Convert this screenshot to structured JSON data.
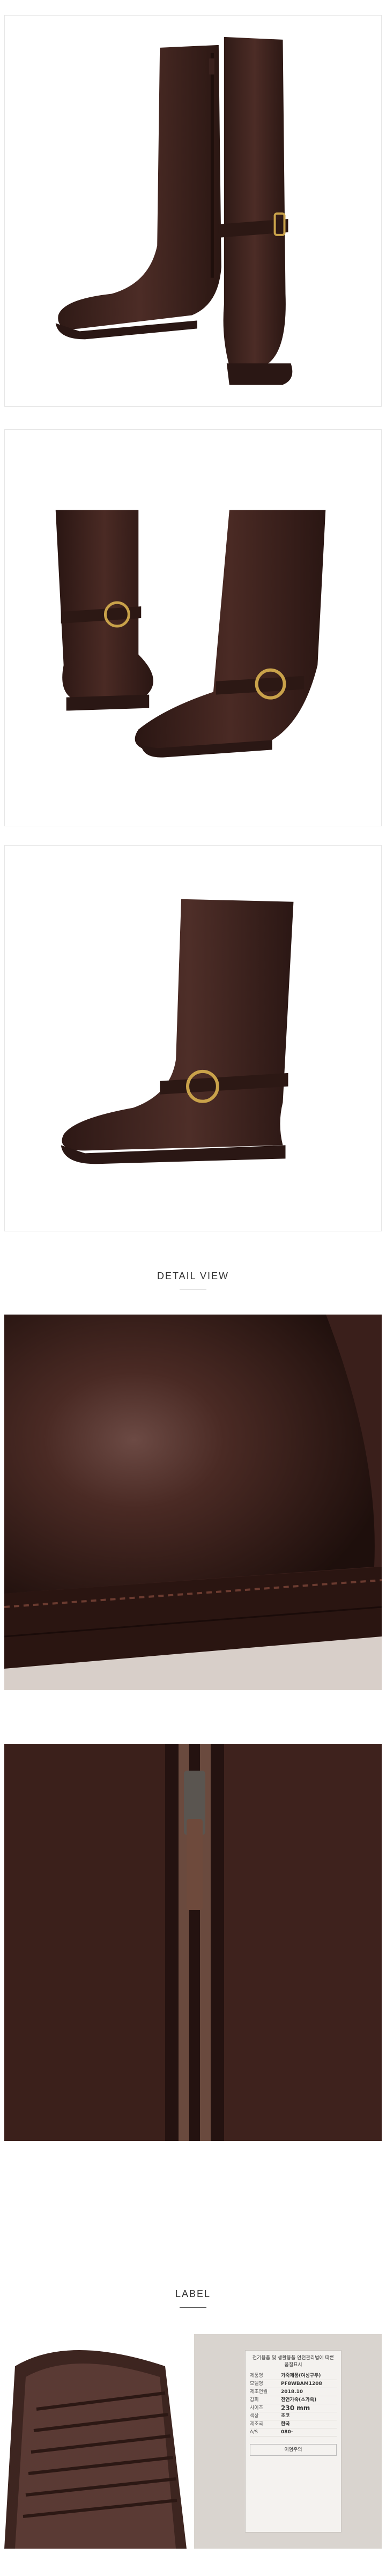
{
  "sections": {
    "detail_title": "DETAIL VIEW",
    "label_title": "LABEL"
  },
  "care_label": {
    "heading": "전기용품 및 생활용품 안전관리법에 따른 품질표시",
    "rows": [
      {
        "key": "제품명",
        "value": "가죽제품(여성구두)"
      },
      {
        "key": "모델명",
        "value": "PF8WBAM1208"
      },
      {
        "key": "제조연월",
        "value": "2018.10"
      },
      {
        "key": "갑피",
        "value": "천연가죽(소가죽)"
      },
      {
        "key": "사이즈",
        "value": "230 mm"
      },
      {
        "key": "색상",
        "value": "초코"
      },
      {
        "key": "제조국",
        "value": "한국"
      },
      {
        "key": "A/S",
        "value": "080-"
      }
    ],
    "warning": "이염주의"
  },
  "colors": {
    "leather": "#3b211c",
    "leather_light": "#5a3630",
    "sole": "#2a1714",
    "buckle": "#c9a24a",
    "background": "#ffffff"
  }
}
